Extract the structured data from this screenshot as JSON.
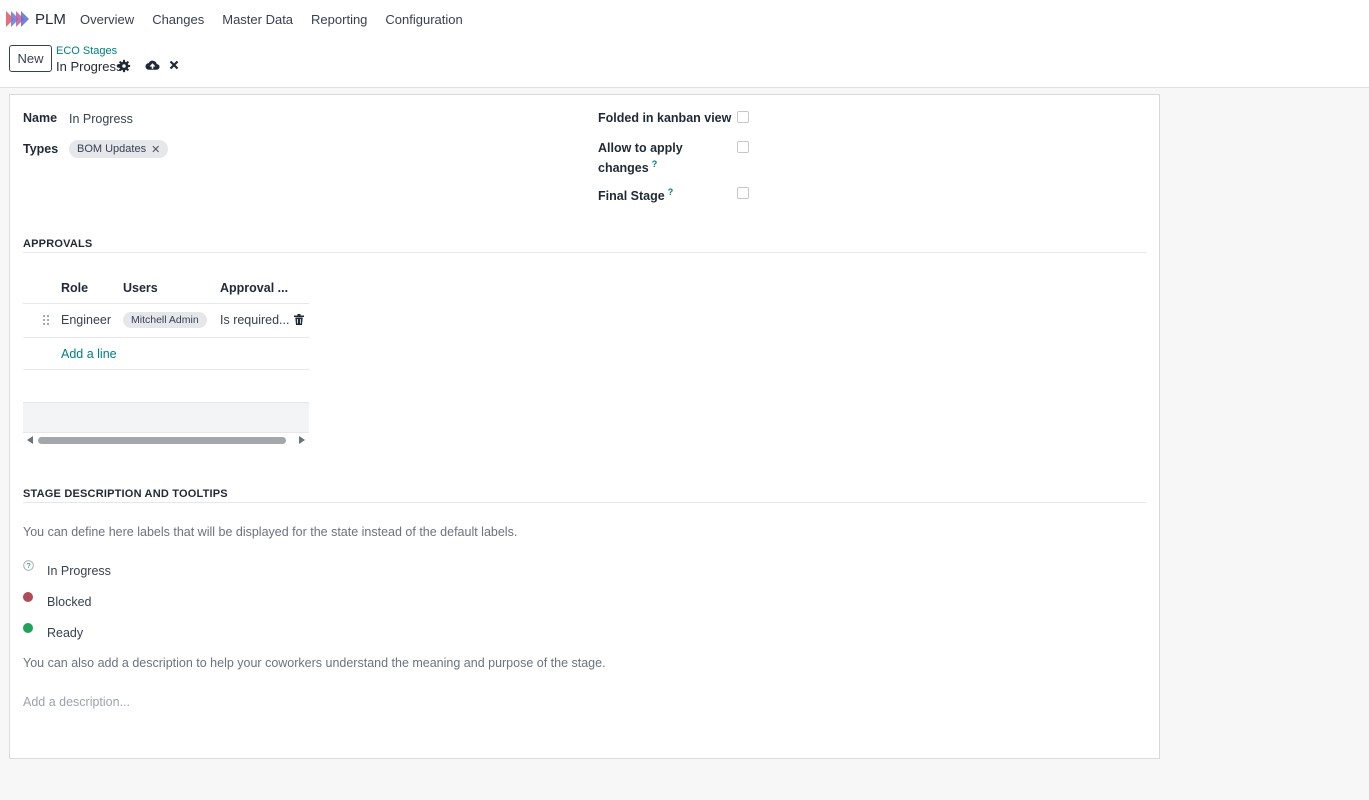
{
  "app": {
    "name": "PLM"
  },
  "menu": [
    "Overview",
    "Changes",
    "Master Data",
    "Reporting",
    "Configuration"
  ],
  "control": {
    "new_label": "New",
    "breadcrumb_parent": "ECO Stages",
    "breadcrumb_current": "In Progress"
  },
  "form": {
    "name_label": "Name",
    "name_value": "In Progress",
    "types_label": "Types",
    "types_tag": "BOM Updates",
    "folded_label": "Folded in kanban view",
    "allow_label_1": "Allow to apply",
    "allow_label_2": "changes",
    "final_label": "Final Stage",
    "tooltip_mark": "?"
  },
  "approvals": {
    "title": "APPROVALS",
    "columns": [
      "Role",
      "Users",
      "Approval ..."
    ],
    "rows": [
      {
        "role": "Engineer",
        "user": "Mitchell Admin",
        "approval": "Is required..."
      }
    ],
    "add_line": "Add a line"
  },
  "stage_desc": {
    "title": "STAGE DESCRIPTION AND TOOLTIPS",
    "intro": "You can define here labels that will be displayed for the state instead of the default labels.",
    "states": [
      {
        "label": "In Progress",
        "color": "#9ca3af"
      },
      {
        "label": "Blocked",
        "color": "#b04a58"
      },
      {
        "label": "Ready",
        "color": "#21a159"
      }
    ],
    "help": "You can also add a description to help your coworkers understand the meaning and purpose of the stage.",
    "description_placeholder": "Add a description..."
  },
  "icons": {
    "gear": "gear-icon",
    "save": "cloud-upload-icon",
    "discard": "close-icon",
    "grip": "drag-handle-icon",
    "trash": "trash-icon"
  },
  "colors": {
    "accent": "#017e84",
    "blocked": "#b04a58",
    "ready": "#21a159"
  }
}
